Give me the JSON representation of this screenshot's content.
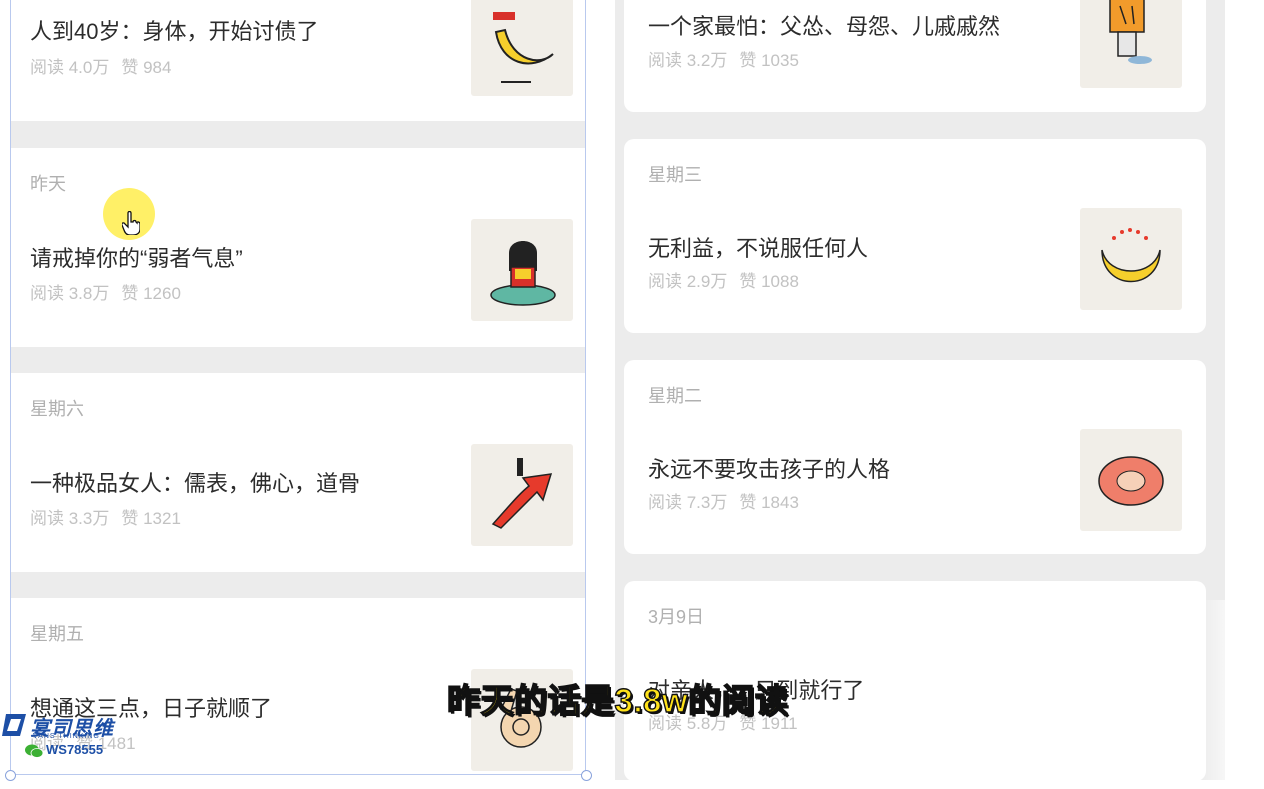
{
  "left_feed": {
    "items": [
      {
        "date": "",
        "title": "人到40岁：身体，开始讨债了",
        "reads": "阅读 4.0万",
        "likes": "赞 984",
        "thumb": "banana-flag-icon"
      },
      {
        "date": "昨天",
        "title": "请戒掉你的“弱者气息”",
        "reads": "阅读 3.8万",
        "likes": "赞 1260",
        "thumb": "girl-reading-icon"
      },
      {
        "date": "星期六",
        "title": "一种极品女人：儒表，佛心，道骨",
        "reads": "阅读 3.3万",
        "likes": "赞 1321",
        "thumb": "red-arrow-icon"
      },
      {
        "date": "星期五",
        "title": "想通这三点，日子就顺了",
        "reads": "阅读",
        "likes": "赞 1481",
        "thumb": "hand-hold-icon"
      }
    ]
  },
  "right_feed": {
    "items": [
      {
        "date": "",
        "title": "一个家最怕：父怂、母怨、儿戚戚然",
        "reads": "阅读 3.2万",
        "likes": "赞 1035",
        "thumb": "box-head-icon"
      },
      {
        "date": "星期三",
        "title": "无利益，不说服任何人",
        "reads": "阅读 2.9万",
        "likes": "赞 1088",
        "thumb": "banana-hearts-icon"
      },
      {
        "date": "星期二",
        "title": "永远不要攻击孩子的人格",
        "reads": "阅读 7.3万",
        "likes": "赞 1843",
        "thumb": "spiky-shell-icon"
      },
      {
        "date": "3月9日",
        "title": "对亲人，...只到就行了",
        "reads": "阅读 5.8万",
        "likes": "赞 1911",
        "thumb": ""
      }
    ]
  },
  "overlay": {
    "subtitle": "昨天的话是3.8w的阅读"
  },
  "watermark": {
    "brand": "宴司思维",
    "brand_en": "VANS THINKING",
    "wechat_id": "WS78555"
  },
  "colors": {
    "selection_border": "#b9c9ee",
    "subtitle_fill": "#ffe21a",
    "cursor_halo": "#ffec3c"
  }
}
